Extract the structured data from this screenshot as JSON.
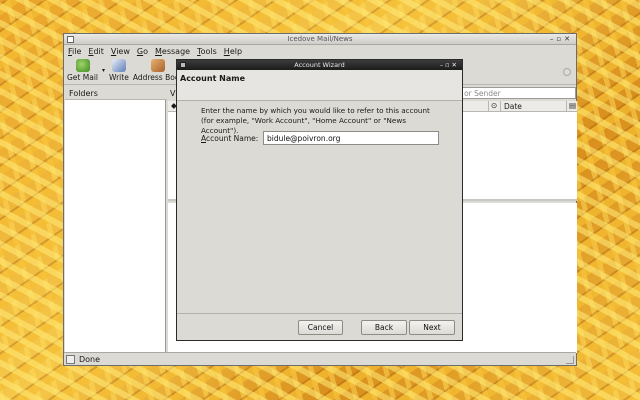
{
  "main_window": {
    "title": "Icedove Mail/News",
    "menu": [
      "File",
      "Edit",
      "View",
      "Go",
      "Message",
      "Tools",
      "Help"
    ],
    "toolbar": {
      "get_mail": "Get Mail",
      "write": "Write",
      "address_book": "Address Book"
    },
    "folders_header": "Folders",
    "view_label": "Vi",
    "search_placeholder": "ect or Sender",
    "columns": {
      "date": "Date"
    },
    "status": "Done"
  },
  "dialog": {
    "title": "Account Wizard",
    "header": "Account Name",
    "description": "Enter the name by which you would like to refer to this account (for example, \"Work Account\", \"Home Account\" or \"News Account\").",
    "field_label": "Account Name:",
    "field_value": "bidule@poivron.org",
    "buttons": {
      "cancel": "Cancel",
      "back": "Back",
      "next": "Next"
    }
  }
}
